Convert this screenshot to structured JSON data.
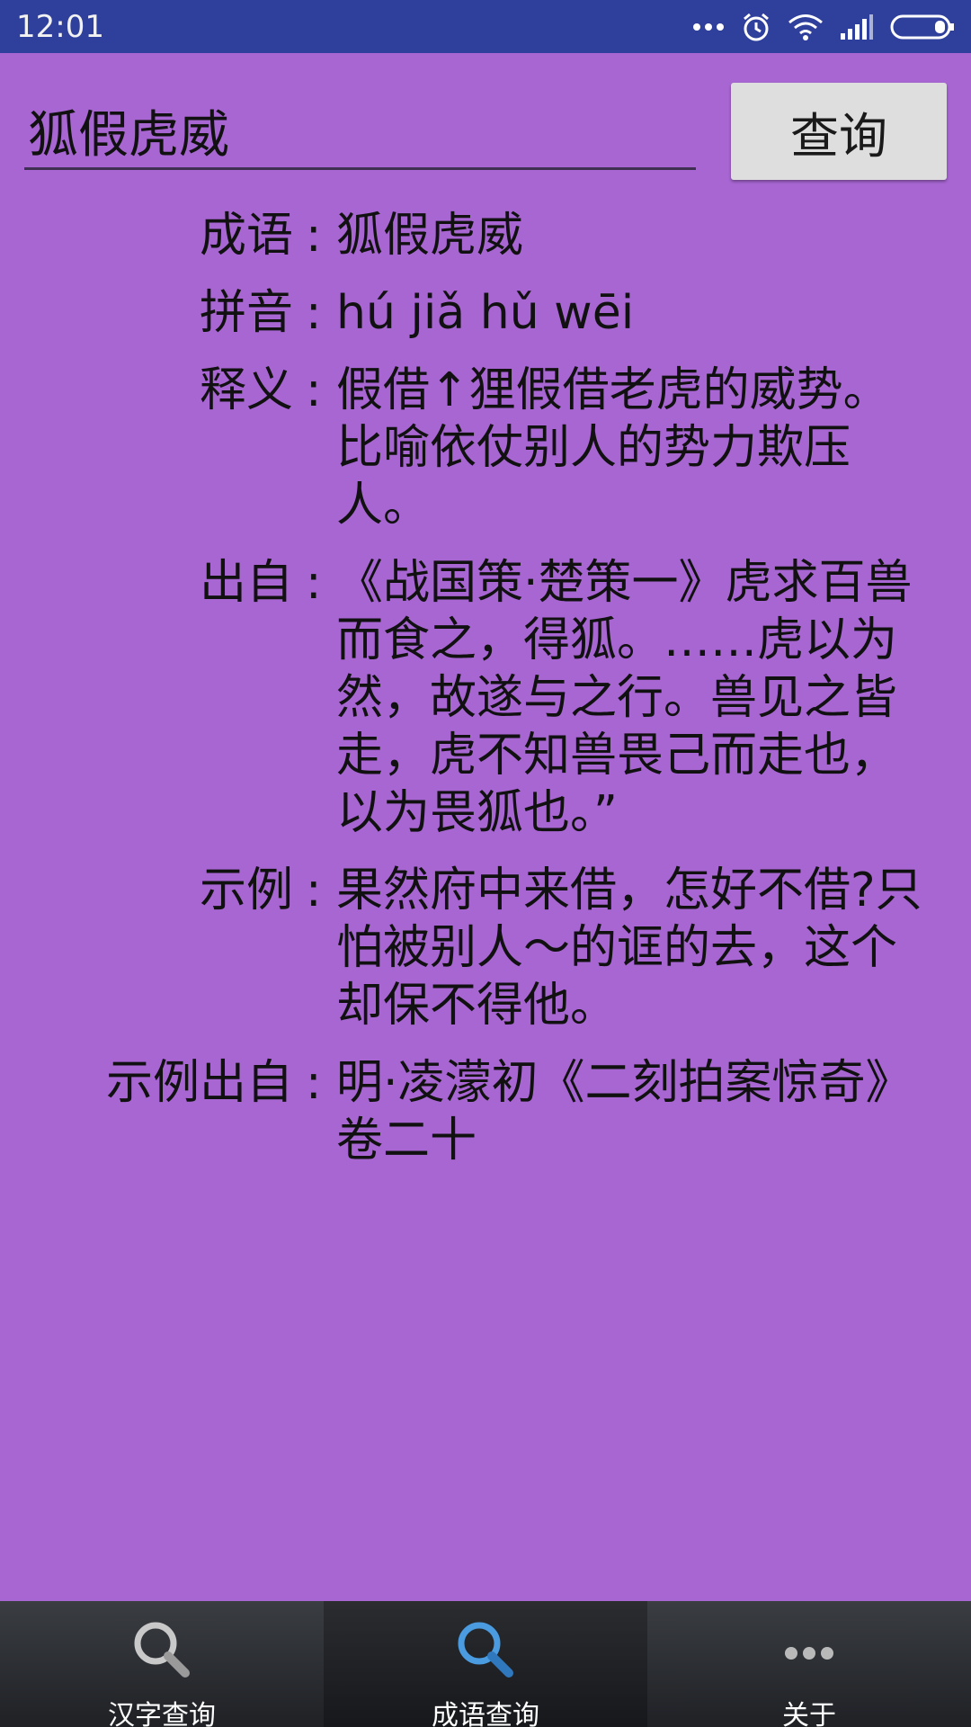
{
  "status_bar": {
    "time": "12:01",
    "icons": [
      "more-dots-icon",
      "alarm-icon",
      "wifi-icon",
      "signal-icon",
      "battery-icon"
    ]
  },
  "search": {
    "value": "狐假虎威",
    "button_label": "查询"
  },
  "colon": ":",
  "results": [
    {
      "label": "成语",
      "value": "狐假虎威"
    },
    {
      "label": "拼音",
      "value": "hú jiǎ hǔ wēi"
    },
    {
      "label": "释义",
      "value": "假借↑狸假借老虎的威势。比喻依仗别人的势力欺压人。"
    },
    {
      "label": "出自",
      "value": "《战国策·楚策一》虎求百兽而食之，得狐。……虎以为然，故遂与之行。兽见之皆走，虎不知兽畏己而走也，以为畏狐也。”"
    },
    {
      "label": "示例",
      "value": "果然府中来借，怎好不借?只怕被别人～的诓的去，这个却保不得他。"
    },
    {
      "label": "示例出自",
      "value": "明·凌濛初《二刻拍案惊奇》卷二十"
    }
  ],
  "bottom_nav": [
    {
      "label": "汉字查询",
      "icon": "search-icon"
    },
    {
      "label": "成语查询",
      "icon": "search-icon",
      "active": true
    },
    {
      "label": "关于",
      "icon": "more-icon"
    }
  ],
  "colors": {
    "background": "#a866d3",
    "status_bar": "#2f3f9c",
    "button": "#dedede",
    "nav_active_icon": "#3d8fd6"
  }
}
